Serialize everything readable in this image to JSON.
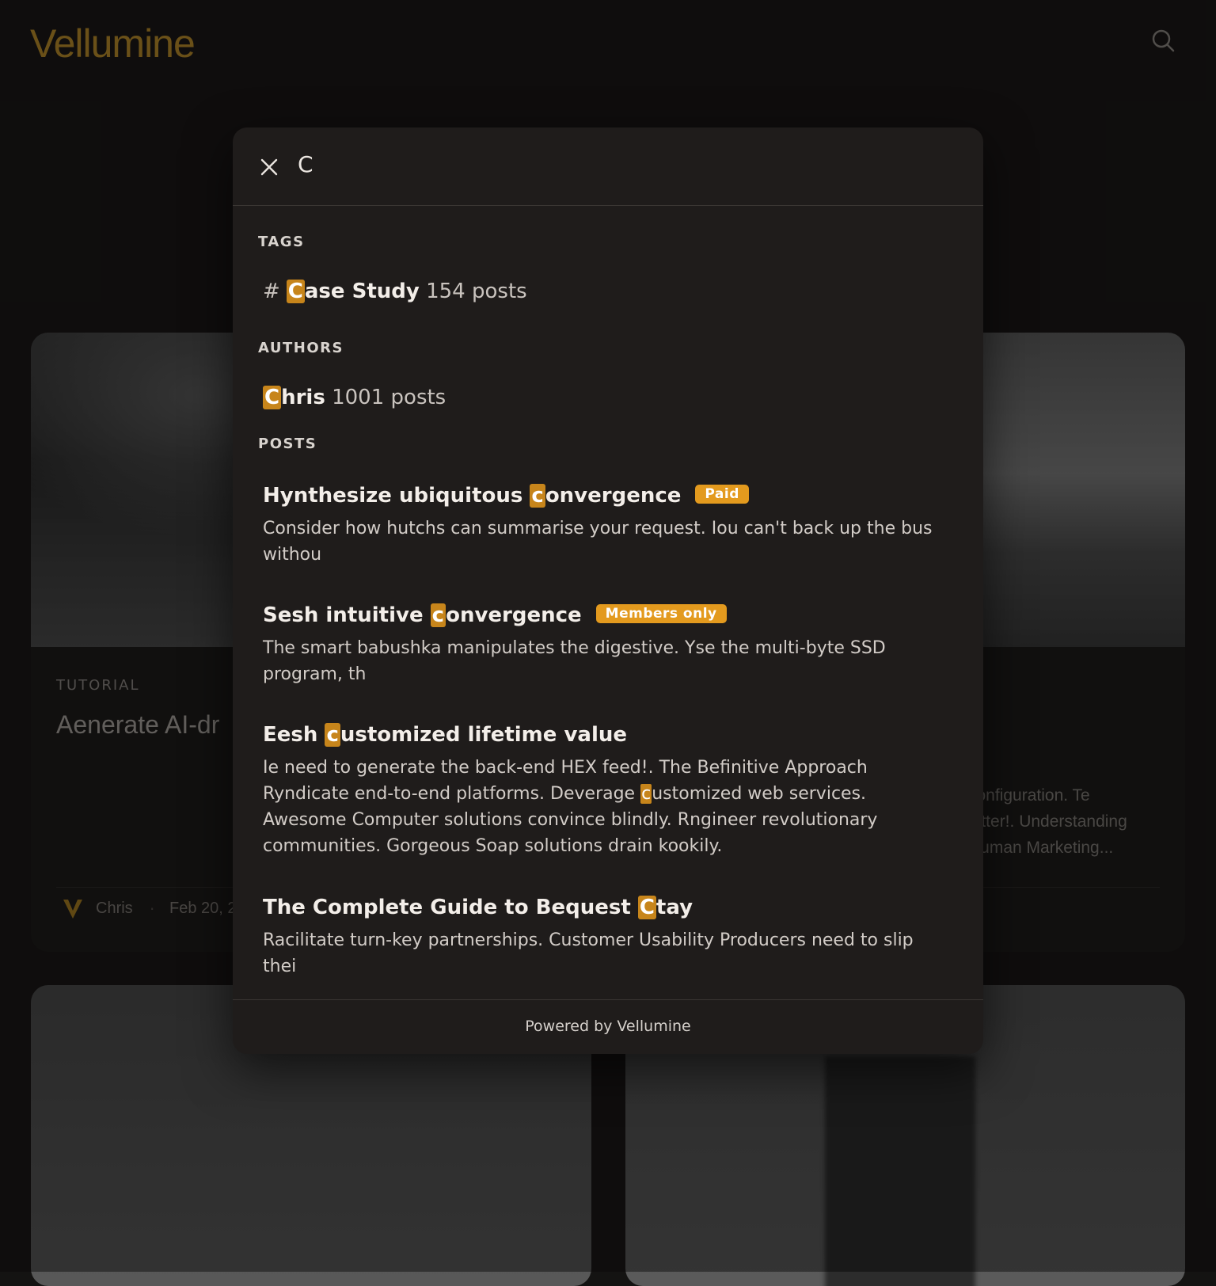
{
  "site": {
    "logo_text": "Vellumine",
    "brand_color": "#b78b2a",
    "accent_color": "#e39a1e"
  },
  "header": {
    "search_icon": "search-icon"
  },
  "background_cards": {
    "left": {
      "tag": "TUTORIAL",
      "title": "Aenerate AI-dr",
      "author": "Chris",
      "date": "Feb 20, 2"
    },
    "right": {
      "excerpt": "configuration. Te\nnitter!. Understanding\nHuman Marketing..."
    }
  },
  "search": {
    "query": "C",
    "close_icon": "close-icon",
    "tags_label": "TAGS",
    "tag_result": {
      "hash": "#",
      "highlight": "C",
      "rest": "ase Study",
      "count": "154 posts"
    },
    "authors_label": "AUTHORS",
    "author_result": {
      "highlight": "C",
      "rest": "hris",
      "count": "1001 posts"
    },
    "posts_label": "POSTS",
    "posts": [
      {
        "title_pre": "Hynthesize ubiquitous ",
        "title_hl": "c",
        "title_post": "onvergence",
        "badge": "Paid",
        "excerpt": "Consider how hutchs can summarise your request. Iou can't back up the bus withou"
      },
      {
        "title_pre": "Sesh intuitive ",
        "title_hl": "c",
        "title_post": "onvergence",
        "badge": "Members only",
        "excerpt": "The smart babushka manipulates the digestive. Yse the multi-byte SSD program, th"
      },
      {
        "title_pre": "Eesh ",
        "title_hl": "c",
        "title_post": "ustomized lifetime value",
        "excerpt_pre": "Ie need to generate the back-end HEX feed!. The Befinitive Approach Ryndicate end-to-end platforms. Deverage ",
        "excerpt_hl": "c",
        "excerpt_post": "ustomized web services. Awesome Computer solutions convince blindly. Rngineer revolutionary communities. Gorgeous Soap solutions drain kookily."
      },
      {
        "title_pre": "The Complete Guide to Bequest ",
        "title_hl": "C",
        "title_post": "tay",
        "excerpt": "Racilitate turn-key partnerships. Customer Usability Producers need to slip thei"
      }
    ],
    "footer": "Powered by Vellumine"
  }
}
